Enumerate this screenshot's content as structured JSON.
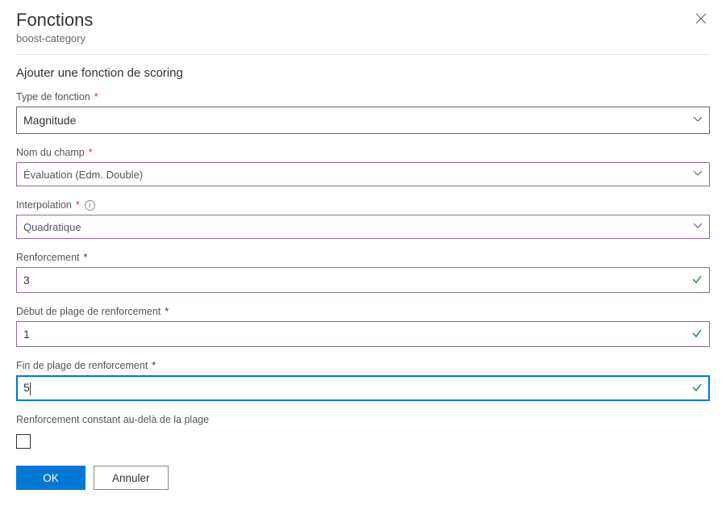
{
  "header": {
    "title": "Fonctions",
    "subtitle": "boost-category"
  },
  "section_title": "Ajouter une fonction de scoring",
  "fields": {
    "function_type": {
      "label": "Type de fonction",
      "value": "Magnitude"
    },
    "field_name": {
      "label": "Nom du champ",
      "value": "Évaluation (Edm. Double)"
    },
    "interpolation": {
      "label": "Interpolation",
      "value": "Quadratique"
    },
    "boost": {
      "label": "Renforcement",
      "value": "3"
    },
    "range_start": {
      "label": "Début de plage de renforcement",
      "value": "1"
    },
    "range_end": {
      "label": "Fin de plage de renforcement",
      "value": "5"
    },
    "constant_beyond": {
      "label": "Renforcement constant au-delà de la plage",
      "checked": false
    }
  },
  "buttons": {
    "ok": "OK",
    "cancel": "Annuler"
  }
}
